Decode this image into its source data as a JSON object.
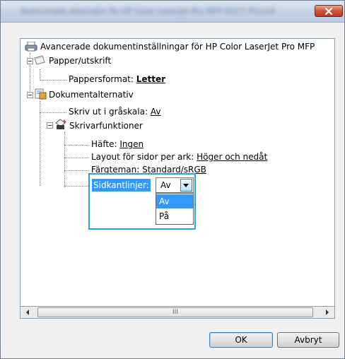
{
  "window": {
    "title": "Avancerade alternativ för HP Color LaserJet Pro MFP M377 PCLmS"
  },
  "tree": {
    "root_label": "Avancerade dokumentinställningar för HP Color LaserJet Pro MFP",
    "paper_label": "Papper/utskrift",
    "paper_size_label": "Pappersformat:",
    "paper_size_value": "Letter",
    "doc_options_label": "Dokumentalternativ",
    "grayscale_label": "Skriv ut i gråskala:",
    "grayscale_value": "Av",
    "printer_features_label": "Skrivarfunktioner",
    "booklet_label": "Häfte:",
    "booklet_value": "Ingen",
    "layout_label": "Layout för sidor per ark:",
    "layout_value": "Höger och nedåt",
    "color_theme_label": "Färgteman:",
    "color_theme_value": "Standard/sRGB",
    "borders_label": "Sidkantlinjer:",
    "borders_value": "Av",
    "borders_options": [
      "Av",
      "På"
    ]
  },
  "scrollbar": {
    "thumb_grip": "III"
  },
  "buttons": {
    "ok": "OK",
    "cancel": "Avbryt"
  },
  "icons": {
    "root": "printer-icon",
    "paper": "paper-icon",
    "doc": "document-options-icon",
    "features": "printer-features-icon"
  },
  "colors": {
    "selection": "#3399ff",
    "highlight_frame": "#2ba4d4",
    "close_button": "#d0543a"
  }
}
